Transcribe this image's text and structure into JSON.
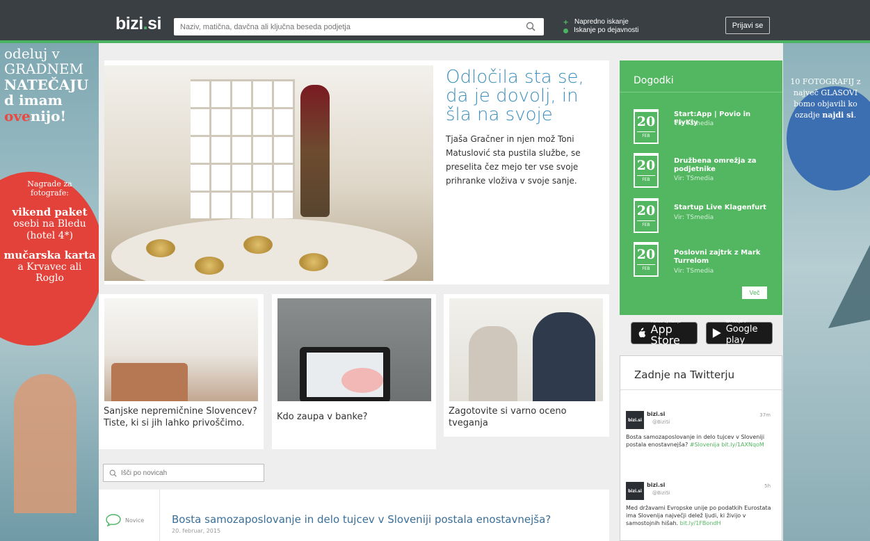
{
  "header": {
    "logo_main": "bizi",
    "logo_dot": ".",
    "logo_tld": "si",
    "search_placeholder": "Naziv, matična, davčna ali ključna beseda podjetja",
    "advanced_search": "Napredno iskanje",
    "activity_search": "Iskanje po dejavnosti",
    "login": "Prijavi se"
  },
  "ad_left": {
    "line1": "odeluj v",
    "line2": "GRADNEM",
    "line3": "NATEČAJU",
    "line4a": "d imam",
    "line4b_pre": "",
    "line4b_red": "ove",
    "line4b_post": "nijo!",
    "prize_head": "Nagrade za fotografe:",
    "prize1": "vikend paket",
    "prize1_sub": "osebi na Bledu (hotel 4*)",
    "prize2": "mučarska karta",
    "prize2_sub": "a Krvavec ali Roglo"
  },
  "ad_right": {
    "text_a": "10 FOTOGRAFIJ z",
    "text_b": "največ GLASOVI",
    "text_c": "bomo objavili ko",
    "text_d_pre": "ozadje ",
    "text_d_bold": "najdi si",
    "text_d_post": "."
  },
  "hero": {
    "title": "Odločila sta se, da je dovolj, in šla na svoje",
    "text": "Tjaša Gračner in njen mož Toni Matuslović sta pustila službe, se preselita čez mejo ter vse svoje prihranke vloživa v svoje sanje."
  },
  "cards": [
    {
      "title": "Sanjske nepremičnine Slovencev? Tiste, ki si jih lahko privoščimo."
    },
    {
      "title": "Kdo zaupa v banke?"
    },
    {
      "title": "Zagotovite si varno oceno tveganja"
    }
  ],
  "news_search": {
    "placeholder": "Išči po novicah"
  },
  "news_item": {
    "category": "Novice",
    "title": "Bosta samozaposlovanje in delo tujcev v Sloveniji postala enostavnejša?",
    "date": "20. februar, 2015"
  },
  "events": {
    "heading": "Dogodki",
    "items": [
      {
        "day": "20",
        "month": "FEB",
        "title": "Start:App | Povio in FlyKly",
        "source": "Vir: TSmedia"
      },
      {
        "day": "20",
        "month": "FEB",
        "title": "Družbena omrežja za podjetnike",
        "source": "Vir: TSmedia"
      },
      {
        "day": "20",
        "month": "FEB",
        "title": "Startup Live Klagenfurt",
        "source": "Vir: TSmedia"
      },
      {
        "day": "20",
        "month": "FEB",
        "title": "Poslovni zajtrk z Mark Turrelom",
        "source": "Vir: TSmedia"
      }
    ],
    "more": "Več"
  },
  "apps": {
    "appstore_small": "Prenesi aplikacijo",
    "appstore_big": "App Store",
    "google_small": "NA VOLJO V",
    "google_big": "Google play"
  },
  "twitter": {
    "heading": "Zadnje na Twitterju",
    "tweets": [
      {
        "avatar": "bizi.si",
        "user": "bizi.si",
        "handle": "@BiziSi",
        "time": "37m",
        "text": "Bosta samozaposlovanje in delo tujcev v Sloveniji postala enostavnejša?",
        "tag": "#Slovenija",
        "link": "bit.ly/1AXNqoM"
      },
      {
        "avatar": "bizi.si",
        "user": "bizi.si",
        "handle": "@BiziSi",
        "time": "5h",
        "text": "Med državami Evropske unije po podatkih Eurostata ima Slovenija največji delež ljudi, ki živijo v samostojnih hišah.",
        "tag": "",
        "link": "bit.ly/1FBondH"
      }
    ]
  },
  "colors": {
    "brand_green": "#4bb462",
    "topbar": "#3a3f43",
    "link_blue": "#3a8fbe"
  },
  "icons": {
    "search": "magnifier-icon",
    "comment": "speech-bubble-icon",
    "apple": "apple-icon",
    "play": "play-triangle-icon"
  }
}
